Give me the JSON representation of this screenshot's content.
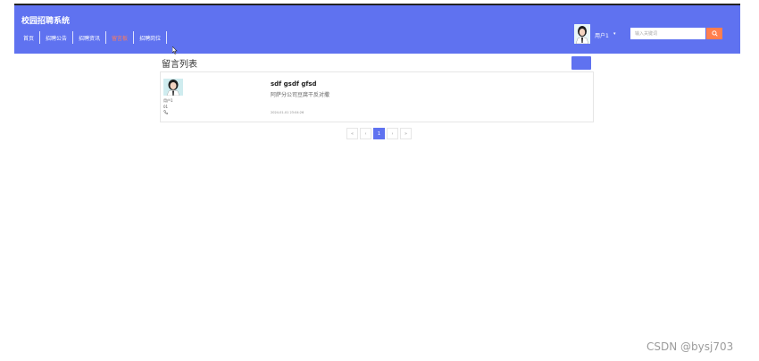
{
  "header": {
    "site_title": "校园招聘系统",
    "nav": [
      {
        "label": "首页",
        "active": false
      },
      {
        "label": "招聘公告",
        "active": false
      },
      {
        "label": "招聘资讯",
        "active": false
      },
      {
        "label": "留言板",
        "active": true
      },
      {
        "label": "招聘岗位",
        "active": false
      }
    ],
    "user": {
      "name": "用户1",
      "caret": "▾"
    },
    "search": {
      "placeholder": "输入关键词",
      "icon": "search-icon"
    },
    "colors": {
      "bar": "#5f72f0",
      "accent": "#ff7b5a",
      "search_button": "#ff7e4e"
    }
  },
  "panel": {
    "title": "留言列表"
  },
  "messages": [
    {
      "username": "用户1",
      "number": "01",
      "phone_icon": "phone-icon",
      "title": "sdf gsdf gfsd",
      "content": "阿萨分公司豆腐干反对撒",
      "time": "2024-01-01 23:04:26"
    }
  ],
  "pagination": {
    "first": "«",
    "prev": "‹",
    "current": "1",
    "next": "›",
    "last": "»"
  },
  "watermark": "CSDN @bysj703"
}
